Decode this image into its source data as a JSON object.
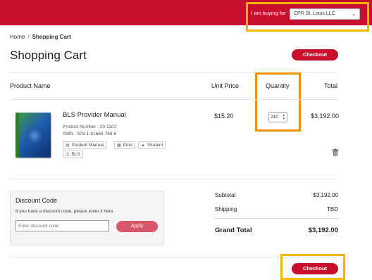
{
  "header": {
    "buyer_label": "I am buying for",
    "buyer_selected": "CPR St. Louis LLC"
  },
  "breadcrumb": {
    "home": "Home",
    "separator": "/",
    "current": "Shopping Cart"
  },
  "page": {
    "title": "Shopping Cart",
    "checkout_label": "Checkout"
  },
  "table": {
    "headers": {
      "product": "Product Name",
      "unit_price": "Unit Price",
      "quantity": "Quantity",
      "total": "Total"
    },
    "rows": [
      {
        "name": "BLS Provider Manual",
        "product_number": "Product Number : 20-1102",
        "isbn": "ISBN : 978-1-61669-768-6",
        "tags": [
          "Student Manual",
          "Print",
          "Student",
          "BLS"
        ],
        "unit_price": "$15.20",
        "quantity": "210",
        "total": "$3,192.00"
      }
    ]
  },
  "discount": {
    "title": "Discount Code",
    "help": "If you have a discount code, please enter it here.",
    "placeholder": "Enter discount code",
    "apply_label": "Apply"
  },
  "summary": {
    "subtotal_label": "Subtotal",
    "subtotal_value": "$3,192.00",
    "shipping_label": "Shipping",
    "shipping_value": "TBD",
    "grand_total_label": "Grand Total",
    "grand_total_value": "$3,192.00"
  },
  "colors": {
    "brand_red": "#c8102e",
    "apply_pink": "#d9576a",
    "highlight_yellow": "#f4b400",
    "highlight_orange": "#f39200"
  },
  "icons": [
    "chevron-down-icon",
    "book-icon",
    "print-icon",
    "student-icon",
    "tag-icon",
    "trash-icon"
  ]
}
